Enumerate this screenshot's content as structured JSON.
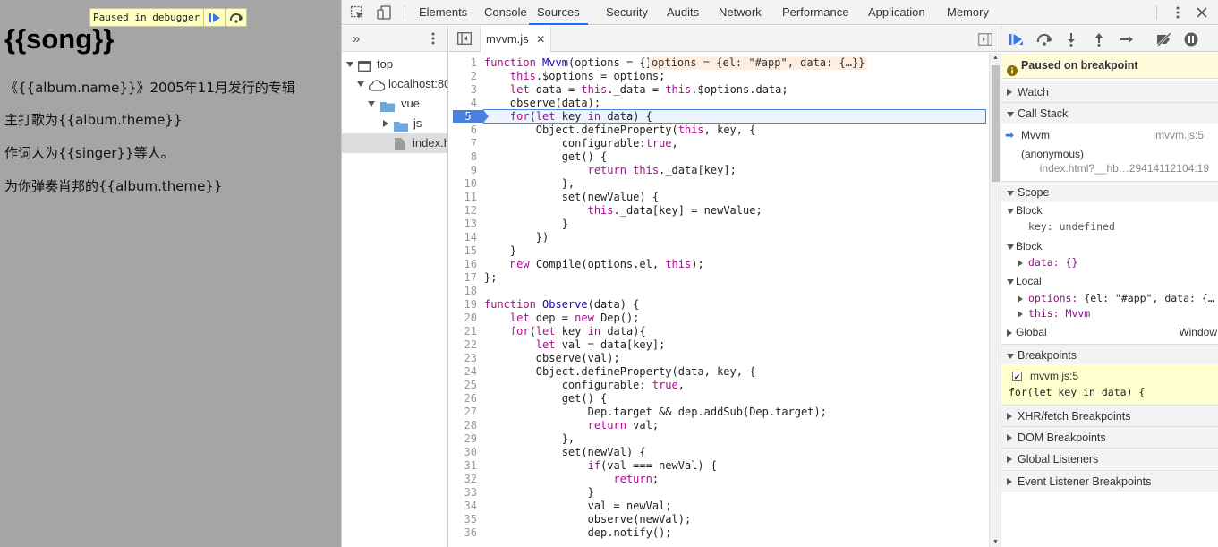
{
  "page": {
    "banner_text": "Paused in debugger",
    "song": "{{song}}",
    "lines": [
      "《{{album.name}}》2005年11月发行的专辑",
      "主打歌为{{album.theme}}",
      "作词人为{{singer}}等人。",
      "为你弹奏肖邦的{{album.theme}}"
    ]
  },
  "devtools": {
    "tabs": [
      "Elements",
      "Console",
      "Sources",
      "Security",
      "Audits",
      "Network",
      "Performance",
      "Application",
      "Memory"
    ],
    "active_tab": "Sources",
    "navigator": {
      "items": [
        {
          "label": "top",
          "icon": "window-icon"
        },
        {
          "label": "localhost:80",
          "icon": "cloud-icon"
        },
        {
          "label": "vue",
          "icon": "folder-icon"
        },
        {
          "label": "js",
          "icon": "folder-icon"
        },
        {
          "label": "index.h",
          "icon": "file-icon"
        }
      ]
    },
    "editor": {
      "file_name": "mvvm.js",
      "breakpoint_line": "5",
      "inline_value": "options = {el: \"#app\", data: {…}}",
      "lines": [
        "function Mvvm(options = {}) {",
        "    this.$options = options;",
        "    let data = this._data = this.$options.data;",
        "    observe(data);",
        "    for(let key in data) {",
        "        Object.defineProperty(this, key, {",
        "            configurable:true,",
        "            get() {",
        "                return this._data[key];",
        "            },",
        "            set(newValue) {",
        "                this._data[key] = newValue;",
        "            }",
        "        })",
        "    }",
        "    new Compile(options.el, this);",
        "};",
        "",
        "function Observe(data) {",
        "    let dep = new Dep();",
        "    for(let key in data){",
        "        let val = data[key];",
        "        observe(val);",
        "        Object.defineProperty(data, key, {",
        "            configurable: true,",
        "            get() {",
        "                Dep.target && dep.addSub(Dep.target);",
        "                return val;",
        "            },",
        "            set(newVal) {",
        "                if(val === newVal) {",
        "                    return;",
        "                }",
        "                val = newVal;",
        "                observe(newVal);",
        "                dep.notify();"
      ]
    },
    "sidebar": {
      "paused_message": "Paused on breakpoint",
      "watch": "Watch",
      "call_stack": "Call Stack",
      "frames": [
        {
          "name": "Mvvm",
          "location": "mvvm.js:5"
        },
        {
          "name": "(anonymous)",
          "location": "index.html?__hb…29414112104:19"
        }
      ],
      "scope": "Scope",
      "block1": "Block",
      "block1_key": "key: undefined",
      "block2": "Block",
      "block2_data": "data: {}",
      "local": "Local",
      "local_options_key": "options: ",
      "local_options_val": "{el: \"#app\", data: {…",
      "local_this": "this: Mvvm",
      "global": "Global",
      "global_val": "Window",
      "breakpoints": "Breakpoints",
      "bp_file": "mvvm.js:5",
      "bp_code": "for(let key in data) {",
      "xhr": "XHR/fetch Breakpoints",
      "dom": "DOM Breakpoints",
      "global_listeners": "Global Listeners",
      "event_listeners": "Event Listener Breakpoints"
    }
  },
  "colors": {
    "accent": "#1a73e8",
    "breakpoint": "#4a7fe2",
    "page_bg": "#a5a5a5",
    "paused_bg": "#fffbdb"
  }
}
